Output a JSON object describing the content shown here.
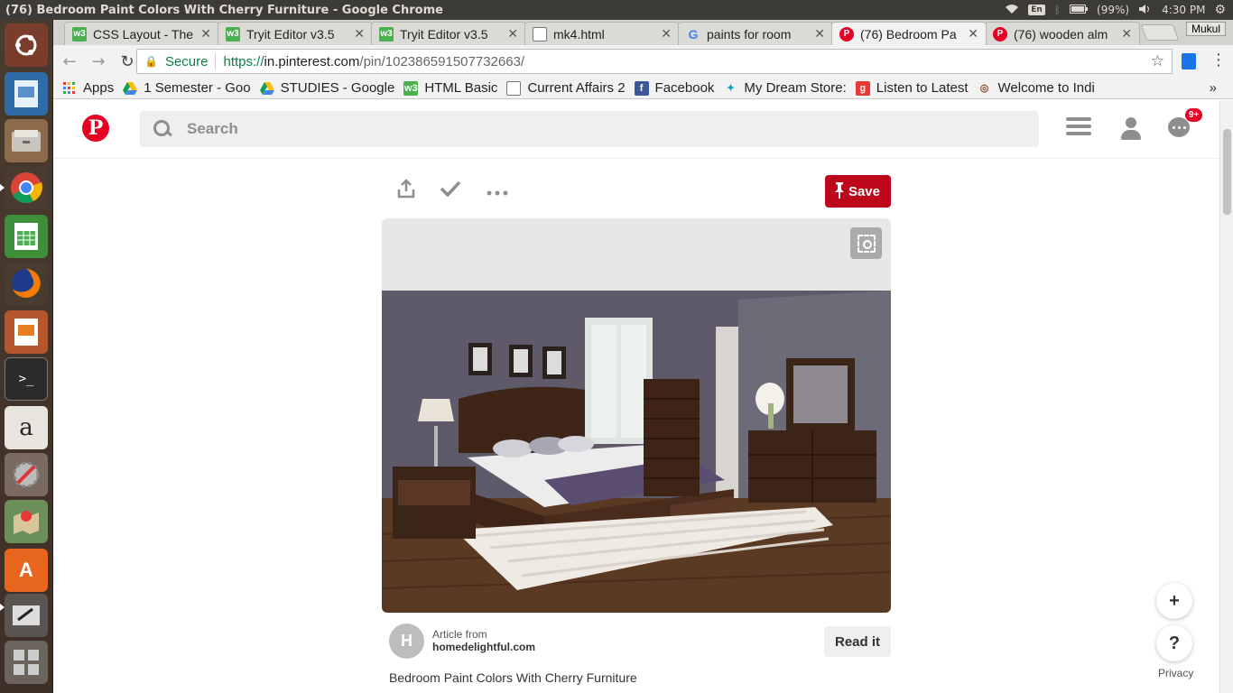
{
  "system_bar": {
    "window_title": "(76) Bedroom Paint Colors With Cherry Furniture - Google Chrome",
    "keyboard": "En",
    "battery": "(99%)",
    "clock": "4:30 PM"
  },
  "launcher": {
    "items": [
      "ubuntu-dash",
      "image-viewer",
      "files",
      "chrome",
      "spreadsheet",
      "firefox",
      "presentation",
      "terminal",
      "amazon",
      "system-settings",
      "maps",
      "software-center",
      "screenshot",
      "workspaces"
    ]
  },
  "tabs": [
    {
      "label": "CSS Layout - The",
      "icon": "w3"
    },
    {
      "label": "Tryit Editor v3.5",
      "icon": "w3"
    },
    {
      "label": "Tryit Editor v3.5",
      "icon": "w3"
    },
    {
      "label": "mk4.html",
      "icon": "page"
    },
    {
      "label": "paints for room",
      "icon": "google"
    },
    {
      "label": "(76) Bedroom Pa",
      "icon": "pinterest"
    },
    {
      "label": "(76) wooden alm",
      "icon": "pinterest"
    }
  ],
  "profile_name": "Mukul",
  "omnibox": {
    "secure_label": "Secure",
    "url_scheme": "https://",
    "url_host": "in.pinterest.com",
    "url_path": "/pin/102386591507732663/"
  },
  "bookmarks": [
    {
      "label": "Apps",
      "icon": "apps"
    },
    {
      "label": "1 Semester - Goo",
      "icon": "drive"
    },
    {
      "label": "STUDIES - Google",
      "icon": "drive"
    },
    {
      "label": "HTML Basic",
      "icon": "w3"
    },
    {
      "label": "Current Affairs 2",
      "icon": "page"
    },
    {
      "label": "Facebook",
      "icon": "facebook"
    },
    {
      "label": "My Dream Store:",
      "icon": "store"
    },
    {
      "label": "Listen to Latest",
      "icon": "gaana"
    },
    {
      "label": "Welcome to Indi",
      "icon": "irctc"
    }
  ],
  "bookmarks_more": "»",
  "pinterest": {
    "logo": "P",
    "search_placeholder": "Search",
    "notifications_badge": "9+",
    "save_label": "Save",
    "article_from": "Article from",
    "article_domain": "homedelightful.com",
    "avatar_letter": "H",
    "read_it_label": "Read it",
    "description": "Bedroom Paint Colors With Cherry Furniture",
    "plus_label": "+",
    "help_label": "?",
    "privacy_label": "Privacy"
  },
  "colors": {
    "pinterest_red": "#bd081c",
    "chrome_toolbar": "#f2f2f2",
    "launcher_bg": "#4a3b30"
  }
}
